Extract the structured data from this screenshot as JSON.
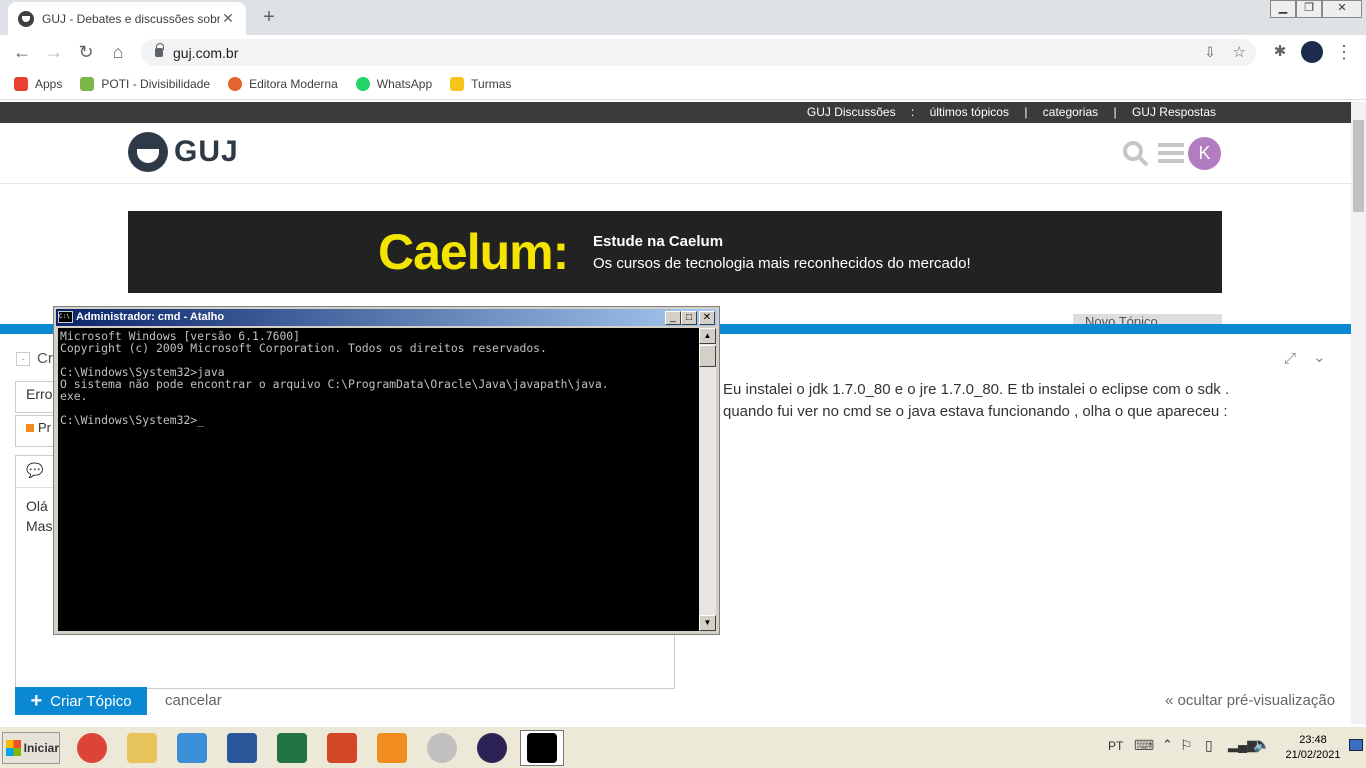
{
  "browser": {
    "tab_title": "GUJ - Debates e discussões sobre p",
    "url": "guj.com.br",
    "bookmarks": [
      {
        "label": "Apps",
        "color": "#e94235"
      },
      {
        "label": "POTI - Divisibilidade",
        "color": "#7ab648"
      },
      {
        "label": "Editora Moderna",
        "color": "#e6622f"
      },
      {
        "label": "WhatsApp",
        "color": "#25d366"
      },
      {
        "label": "Turmas",
        "color": "#f5c518"
      }
    ]
  },
  "guj": {
    "top_links": [
      "GUJ Discussões",
      ":",
      "últimos tópicos",
      "|",
      "categorias",
      "|",
      "GUJ Respostas"
    ],
    "logo_text": "GUJ",
    "avatar_letter": "K",
    "banner": {
      "brand": "Caelum:",
      "headline": "Estude na Caelum",
      "sub": "Os cursos de tecnologia mais reconhecidos do mercado!"
    },
    "novo_topico_partial": "Novo Tópico",
    "compose": {
      "header_partial": "Cr",
      "title_partial": "Erro",
      "category_partial": "Pr",
      "body_line1": "Olá",
      "body_line2": "Mas"
    },
    "preview_lines": [
      "Eu instalei o jdk 1.7.0_80 e o jre 1.7.0_80. E tb instalei o eclipse com o sdk .",
      "quando fui ver no cmd se o java estava funcionando , olha o que apareceu :"
    ],
    "criar_label": "Criar Tópico",
    "cancelar_label": "cancelar",
    "ocultar_label": "« ocultar pré-visualização"
  },
  "cmd": {
    "title": "Administrador: cmd - Atalho",
    "lines": [
      "Microsoft Windows [versão 6.1.7600]",
      "Copyright (c) 2009 Microsoft Corporation. Todos os direitos reservados.",
      "",
      "C:\\Windows\\System32>java",
      "O sistema não pode encontrar o arquivo C:\\ProgramData\\Oracle\\Java\\javapath\\java.",
      "exe.",
      "",
      "C:\\Windows\\System32>_"
    ]
  },
  "taskbar": {
    "start_label": "Iniciar",
    "apps": [
      {
        "name": "chrome",
        "color": "#db4437"
      },
      {
        "name": "explorer",
        "color": "#e8c55c"
      },
      {
        "name": "media",
        "color": "#3a8fd6"
      },
      {
        "name": "word",
        "color": "#2b579a"
      },
      {
        "name": "excel",
        "color": "#217346"
      },
      {
        "name": "powerpoint",
        "color": "#d24726"
      },
      {
        "name": "pdf",
        "color": "#f28c1e"
      },
      {
        "name": "snipping",
        "color": "#c0c0c0"
      },
      {
        "name": "eclipse",
        "color": "#2c2255"
      },
      {
        "name": "cmd",
        "color": "#000000"
      }
    ],
    "lang": "PT",
    "time": "23:48",
    "date": "21/02/2021"
  }
}
